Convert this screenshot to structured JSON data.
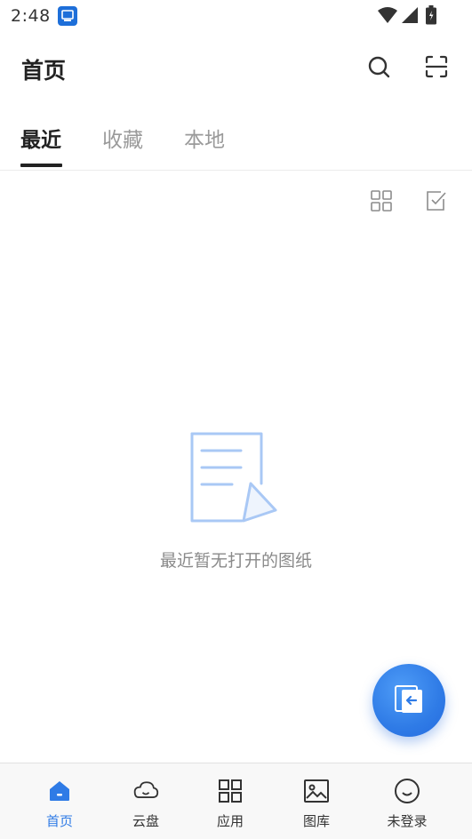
{
  "status_bar": {
    "time": "2:48",
    "app_icon": "notification-app-icon",
    "icons": [
      "wifi-icon",
      "signal-icon",
      "battery-icon"
    ]
  },
  "header": {
    "title": "首页",
    "actions": [
      "search-icon",
      "scan-icon"
    ]
  },
  "tabs": [
    {
      "label": "最近",
      "active": true
    },
    {
      "label": "收藏",
      "active": false
    },
    {
      "label": "本地",
      "active": false
    }
  ],
  "toolbar": {
    "icons": [
      "grid-view-icon",
      "select-checkbox-icon"
    ]
  },
  "empty_state": {
    "icon": "document-cursor-icon",
    "message": "最近暂无打开的图纸"
  },
  "fab": {
    "icon": "import-file-icon"
  },
  "bottom_nav": [
    {
      "label": "首页",
      "icon": "home-icon",
      "active": true
    },
    {
      "label": "云盘",
      "icon": "cloud-icon",
      "active": false
    },
    {
      "label": "应用",
      "icon": "apps-grid-icon",
      "active": false
    },
    {
      "label": "图库",
      "icon": "gallery-icon",
      "active": false
    },
    {
      "label": "未登录",
      "icon": "smiley-face-icon",
      "active": false
    }
  ],
  "colors": {
    "accent": "#2f7be6",
    "illustration": "#a9c8f5",
    "text_primary": "#222222",
    "text_secondary": "#9a9a9a"
  }
}
